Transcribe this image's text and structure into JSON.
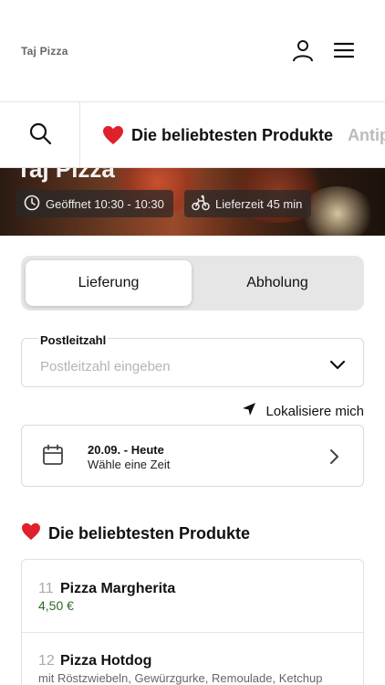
{
  "header": {
    "brand": "Taj Pizza",
    "icons": {
      "user": "user-icon",
      "menu": "menu-icon"
    }
  },
  "categories": {
    "search_icon": "search-icon",
    "active_label": "Die beliebtesten Produkte",
    "next_label": "Antip",
    "heart_icon": "heart-icon"
  },
  "hero": {
    "title": "Taj Pizza",
    "opening": "Geöffnet 10:30 - 10:30",
    "delivery_time": "Lieferzeit 45 min",
    "icons": {
      "clock": "clock-icon",
      "bike": "bike-icon"
    }
  },
  "order_mode": {
    "delivery": "Lieferung",
    "pickup": "Abholung",
    "selected": "Lieferung"
  },
  "zip": {
    "label": "Postleitzahl",
    "placeholder": "Postleitzahl eingeben"
  },
  "locate": {
    "label": "Lokalisiere mich"
  },
  "date": {
    "main": "20.09. - Heute",
    "sub": "Wähle eine Zeit"
  },
  "popular": {
    "title": "Die beliebtesten Produkte",
    "products": [
      {
        "number": "11",
        "name": "Pizza Margherita",
        "price": "4,50 €"
      },
      {
        "number": "12",
        "name": "Pizza Hotdog",
        "description": "mit Röstzwiebeln, Gewürzgurke, Remoulade, Ketchup"
      }
    ]
  },
  "colors": {
    "price_green": "#2f6a2a",
    "heart_red": "#e0202a",
    "segment_bg": "#e6e6e6"
  }
}
